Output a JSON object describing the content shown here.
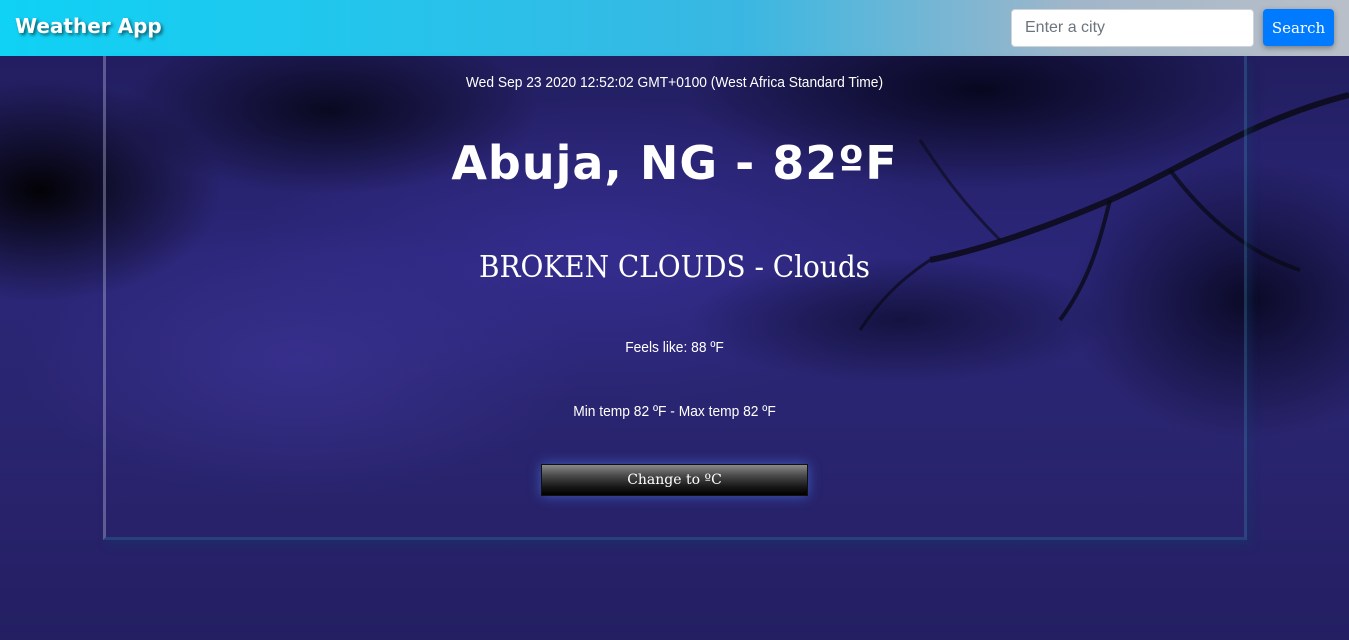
{
  "navbar": {
    "brand": "Weather App",
    "search_placeholder": "Enter a city",
    "search_value": "",
    "search_label": "Search"
  },
  "weather": {
    "datetime": "Wed Sep 23 2020 12:52:02 GMT+0100 (West Africa Standard Time)",
    "location_temp": "Abuja, NG - 82ºF",
    "description": "BROKEN CLOUDS - Clouds",
    "feels_like": "Feels like: 88 ºF",
    "min_max": "Min temp 82 ºF - Max temp 82 ºF",
    "unit_toggle_label": "Change to ºC"
  },
  "colors": {
    "navbar_start": "#0fd2f5",
    "navbar_end": "#b9bfc8",
    "search_button": "#007bff",
    "text": "#ffffff",
    "background": "#2a2570"
  },
  "icons": []
}
